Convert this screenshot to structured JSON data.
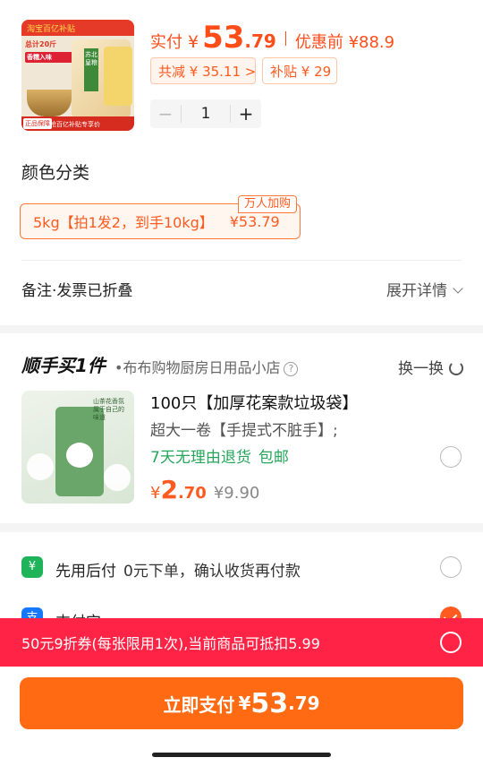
{
  "product": {
    "thumb_badge": "淘宝百亿补贴",
    "thumb_promo": "总计20斤",
    "thumb_promo_sub": "香糯入味",
    "thumb_footer": "下拉详情抢百亿补贴专享价",
    "thumb_guarantee": "正品保障",
    "thumb_bag_label": "苏北皇粮",
    "pay_label": "实付",
    "currency": "¥",
    "price_int": "53",
    "price_dec": ".79",
    "pre_price": "优惠前 ¥88.9",
    "reduce_tag": "共减 ¥ 35.11 >",
    "subsidy_tag": "补贴 ¥ 29",
    "quantity": "1",
    "minus": "−",
    "plus": "+"
  },
  "variant": {
    "section_title": "颜色分类",
    "option_label": "5kg【拍1发2，到手10kg】",
    "option_price": "¥53.79",
    "badge": "万人加购"
  },
  "remark": {
    "label": "备注·发票已折叠",
    "expand": "展开详情"
  },
  "addon": {
    "title": "顺手买1件",
    "shop": "•布布购物厨房日用品小店",
    "help": "?",
    "swap": "换一换",
    "thumb_caption": "山茶花香氛 属于自己的味道",
    "name": "100只【加厚花案款垃圾袋】",
    "desc": "超大一卷【手提式不脏手】;",
    "return_policy": "7天无理由退货",
    "shipping": "包邮",
    "currency": "¥",
    "price_int": "2",
    "price_dec": ".70",
    "old_price": "¥9.90"
  },
  "payment": {
    "option1_icon": "¥",
    "option1_title": "先用后付",
    "option1_sub": "0元下单，确认收货再付款",
    "option2_icon": "支",
    "option2_title": "支付宝"
  },
  "coupon": {
    "text": "50元9折券(每张限用1次),当前商品可抵扣5.99"
  },
  "submit": {
    "label": "立即支付",
    "currency": "¥",
    "price_int": "53",
    "price_dec": ".79"
  }
}
